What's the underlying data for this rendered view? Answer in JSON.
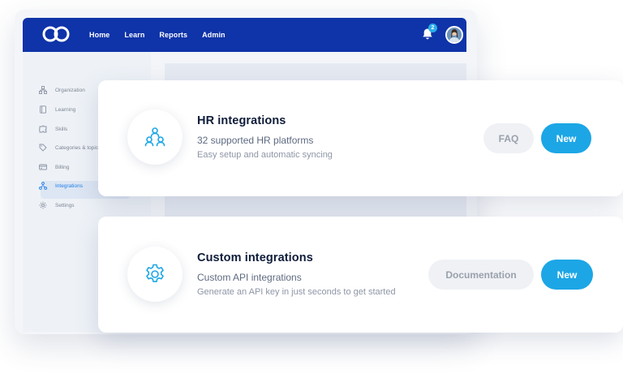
{
  "topbar": {
    "nav": [
      "Home",
      "Learn",
      "Reports",
      "Admin"
    ],
    "notifications_count": "2"
  },
  "sidebar": {
    "items": [
      {
        "label": "Organization",
        "icon": "org-icon"
      },
      {
        "label": "Learning",
        "icon": "book-icon"
      },
      {
        "label": "Skills",
        "icon": "puzzle-icon"
      },
      {
        "label": "Categories & topic",
        "icon": "tag-icon"
      },
      {
        "label": "Billing",
        "icon": "card-icon"
      },
      {
        "label": "Integrations",
        "icon": "integration-icon",
        "active": true
      },
      {
        "label": "Settings",
        "icon": "gear-icon"
      }
    ]
  },
  "cards": {
    "hr": {
      "title": "HR integrations",
      "subtitle": "32 supported HR platforms",
      "description": "Easy setup and automatic syncing",
      "secondary_button": "FAQ",
      "primary_button": "New",
      "icon": "users-network-icon"
    },
    "custom": {
      "title": "Custom integrations",
      "subtitle": "Custom API integrations",
      "description": "Generate an API key in just seconds to get started",
      "secondary_button": "Documentation",
      "primary_button": "New",
      "icon": "gear-icon"
    }
  },
  "colors": {
    "brand_blue": "#0f33a8",
    "accent": "#1ca6e6",
    "active_link": "#1f7fe6"
  }
}
